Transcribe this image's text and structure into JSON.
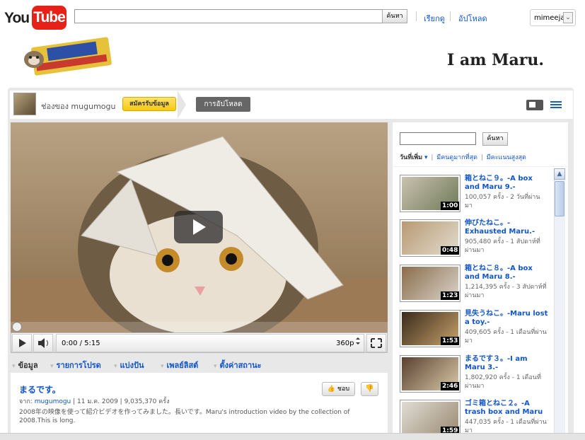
{
  "topbar": {
    "logo_you": "You",
    "logo_tube": "Tube",
    "search_button": "ค้นหา",
    "browse_link": "เรียกดู",
    "upload_link": "อัปโหลด",
    "username": "mimeeja",
    "user_menu_arrow": "⌄"
  },
  "banner": {
    "title": "I am Maru."
  },
  "channel": {
    "name": "ช่องของ mugumogu",
    "subscribe": "สมัครรับข้อมูล",
    "uploads_tab": "การอัปโหลด"
  },
  "player": {
    "time": "0:00 / 5:15",
    "quality": "360p"
  },
  "tabs": [
    {
      "label": "ข้อมูล"
    },
    {
      "label": "รายการโปรด"
    },
    {
      "label": "แบ่งปัน"
    },
    {
      "label": "เพลย์ลิสต์"
    },
    {
      "label": "ตั้งค่าสถานะ"
    }
  ],
  "video": {
    "title": "まるです。",
    "from_label": "จาก:",
    "author": "mugumogu",
    "date": "11 ม.ค. 2009",
    "views": "9,035,370 ครั้ง",
    "description": "2008年の映像を使って紹介ビデオを作ってみました。長いです。Maru's introduction video by the collection of 2008.This is long.",
    "like": "ชอบ"
  },
  "sidebar": {
    "search_button": "ค้นหา",
    "sort_date": "วันที่เพิ่ม",
    "sort_views": "มีคนดูมากที่สุด",
    "sort_rating": "มีคะแนนสูงสุด",
    "items": [
      {
        "title": "箱とねこ９。-A box and Maru 9.-",
        "meta": "100,057 ครั้ง - 2 วันที่ผ่านมา",
        "duration": "1:00"
      },
      {
        "title": "伸びたねこ。-Exhausted Maru.-",
        "meta": "905,480 ครั้ง - 1 สัปดาห์ที่ผ่านมา",
        "duration": "0:48"
      },
      {
        "title": "箱とねこ８。-A box and Maru 8.-",
        "meta": "1,214,395 ครั้ง - 3 สัปดาห์ที่ผ่านมา",
        "duration": "1:23"
      },
      {
        "title": "見失うねこ。-Maru lost a toy.-",
        "meta": "409,605 ครั้ง - 1 เดือนที่ผ่านมา",
        "duration": "1:53"
      },
      {
        "title": "まるです３。-I am Maru 3.-",
        "meta": "1,802,920 ครั้ง - 1 เดือนที่ผ่านมา",
        "duration": "2:46"
      },
      {
        "title": "ゴミ箱とねこ２。-A trash box and Maru",
        "meta": "447,035 ครั้ง - 1 เดือนที่ผ่านมา",
        "duration": "1:59"
      }
    ]
  },
  "colors": {
    "link": "#1155cc",
    "youtube_red": "#e62117",
    "subscribe": "#f6c90e"
  }
}
